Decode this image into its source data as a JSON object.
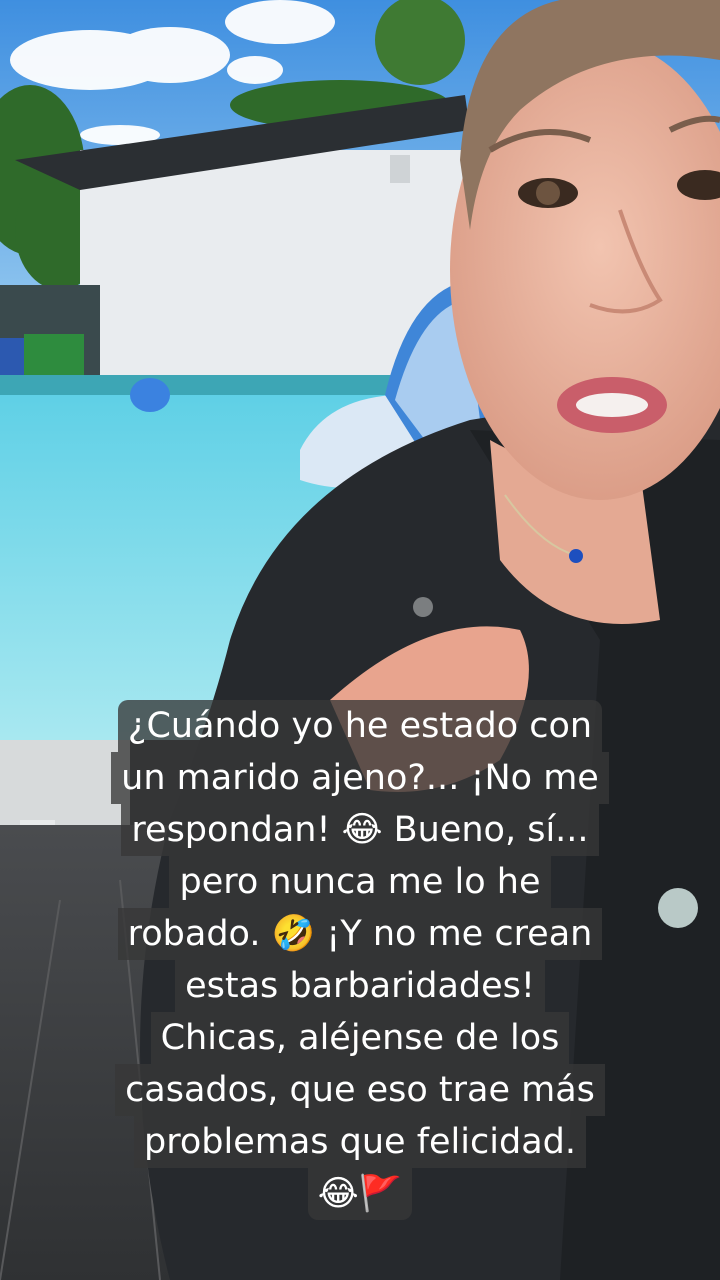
{
  "caption": {
    "lines": [
      "¿Cuándo yo he estado con",
      "un marido ajeno?... ¡No me",
      "respondan! 😂 Bueno, sí...",
      "pero nunca me lo he",
      "robado. 🤣 ¡Y no me crean",
      "estas barbaridades!",
      "Chicas, aléjense de los",
      "casados, que eso trae más",
      "problemas que felicidad.",
      "😂🚩"
    ]
  },
  "colors": {
    "sky": "#5aa6e8",
    "pool_water": "#7fd6ea",
    "jacket": "#26292d",
    "skin": "#e9b49e",
    "caption_bg": "#373737"
  }
}
